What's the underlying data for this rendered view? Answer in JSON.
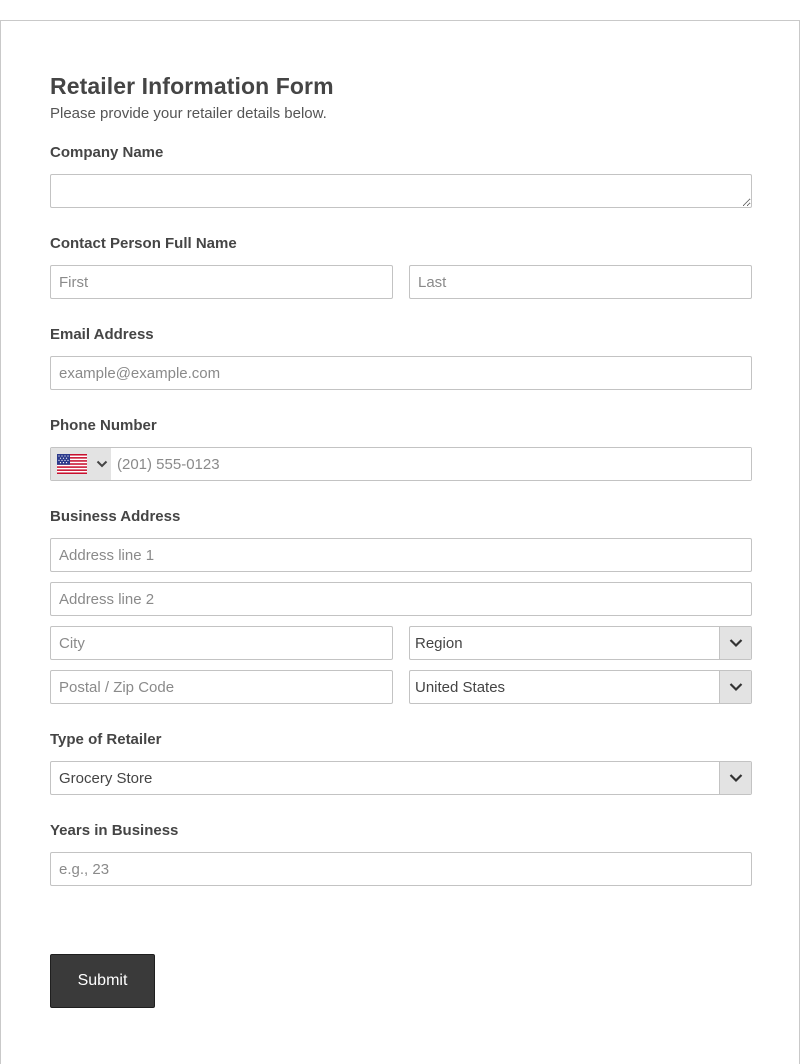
{
  "form": {
    "title": "Retailer Information Form",
    "subtitle": "Please provide your retailer details below.",
    "company_name": {
      "label": "Company Name",
      "value": "",
      "placeholder": ""
    },
    "contact_name": {
      "label": "Contact Person Full Name",
      "first_placeholder": "First",
      "last_placeholder": "Last"
    },
    "email": {
      "label": "Email Address",
      "placeholder": "example@example.com"
    },
    "phone": {
      "label": "Phone Number",
      "country_icon": "us-flag-icon",
      "placeholder": "(201) 555-0123"
    },
    "address": {
      "label": "Business Address",
      "line1_placeholder": "Address line 1",
      "line2_placeholder": "Address line 2",
      "city_placeholder": "City",
      "region_value": "Region",
      "postal_placeholder": "Postal / Zip Code",
      "country_value": "United States"
    },
    "retailer_type": {
      "label": "Type of Retailer",
      "value": "Grocery Store"
    },
    "years": {
      "label": "Years in Business",
      "placeholder": "e.g., 23"
    },
    "submit_label": "Submit"
  },
  "colors": {
    "button_bg": "#3a3a3a",
    "border": "#c3c3c3",
    "select_arrow_bg": "#e3e3e3",
    "text": "#454545"
  }
}
